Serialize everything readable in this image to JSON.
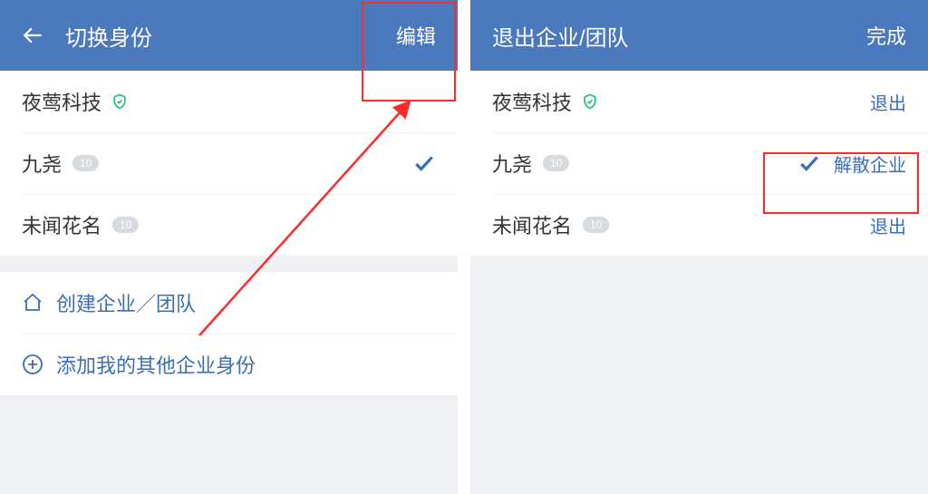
{
  "left": {
    "header": {
      "title": "切换身份",
      "action": "编辑"
    },
    "rows": [
      {
        "name": "夜莺科技",
        "verified": true
      },
      {
        "name": "九尧",
        "badge": "10",
        "selected": true
      },
      {
        "name": "未闻花名",
        "badge": "10"
      }
    ],
    "options": [
      {
        "icon": "home",
        "label": "创建企业／团队"
      },
      {
        "icon": "plus",
        "label": "添加我的其他企业身份"
      }
    ]
  },
  "right": {
    "header": {
      "title": "退出企业/团队",
      "action": "完成"
    },
    "rows": [
      {
        "name": "夜莺科技",
        "verified": true,
        "action": "退出"
      },
      {
        "name": "九尧",
        "badge": "10",
        "selected": true,
        "action": "解散企业"
      },
      {
        "name": "未闻花名",
        "badge": "10",
        "action": "退出"
      }
    ]
  }
}
